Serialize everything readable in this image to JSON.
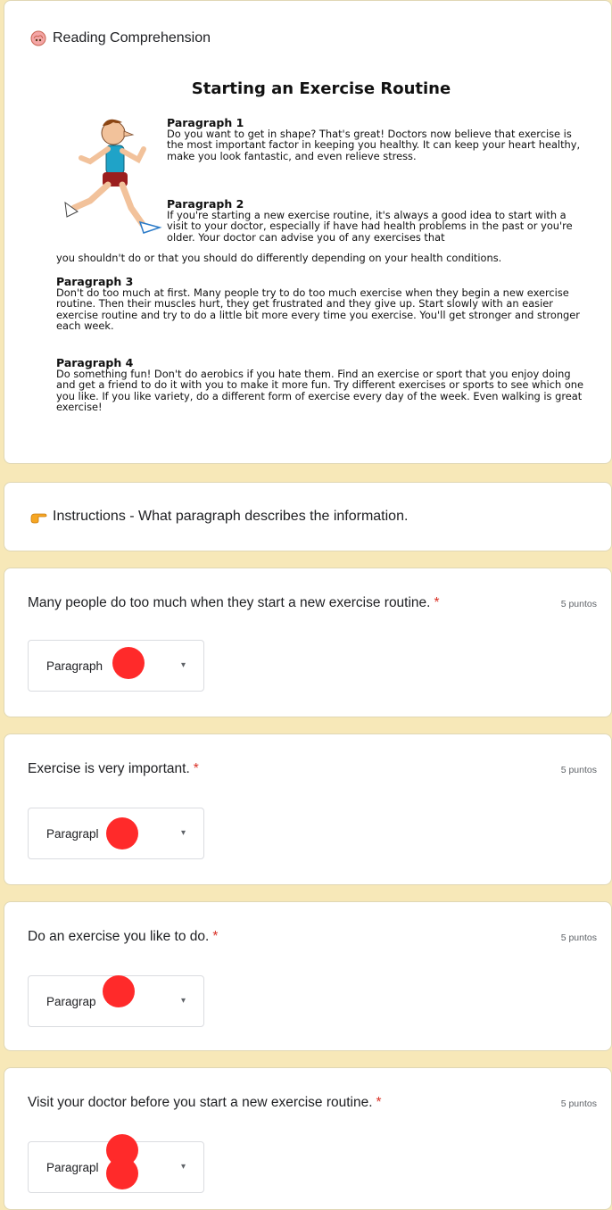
{
  "reading_card": {
    "icon": "brain-emoji-icon",
    "header": "Reading Comprehension",
    "passage": {
      "title": "Starting an Exercise Routine",
      "paragraphs": [
        {
          "heading": "Paragraph 1",
          "text": "Do you want to get in shape?  That's great!  Doctors now believe that exercise is the most important factor in keeping you healthy.  It can keep your heart healthy, make you look fantastic, and even relieve stress."
        },
        {
          "heading": "Paragraph 2",
          "text": "If you're starting a new exercise routine, it's always a good idea to start with a visit to your doctor, especially if have had health problems in the past or you're older.  Your doctor can advise you of any exercises that",
          "tail": "you shouldn't do or that you should do differently depending on your health conditions."
        },
        {
          "heading": "Paragraph 3",
          "text": "Don't do too much at first.  Many people try to do too much exercise when they begin a new exercise routine.  Then their muscles hurt, they get frustrated and they give up.  Start slowly with an easier exercise routine and try to do a little bit more every time you exercise.  You'll get stronger and stronger each week."
        },
        {
          "heading": "Paragraph 4",
          "text": "Do something fun!  Don't do aerobics if you hate them.  Find an exercise or sport that you enjoy doing and get a friend to do it with you to make it more fun.  Try different exercises or sports to see which one you like.  If you like variety, do a different form of exercise every day of the week.  Even walking is great exercise!"
        }
      ]
    }
  },
  "instructions_card": {
    "icon": "pointing-hand-icon",
    "text": "Instructions - What paragraph describes the information."
  },
  "questions": [
    {
      "text": "Many people do too much when they start a new exercise routine.",
      "required": "*",
      "points": "5 puntos",
      "selected": "Paragraph"
    },
    {
      "text": "Exercise is very important.",
      "required": "*",
      "points": "5 puntos",
      "selected": "Paragrapl"
    },
    {
      "text": "Do an exercise you like to do.",
      "required": "*",
      "points": "5 puntos",
      "selected": "Paragrap"
    },
    {
      "text": "Visit your doctor before you start a new exercise routine.",
      "required": "*",
      "points": "5 puntos",
      "selected": "Paragrapl"
    }
  ],
  "colors": {
    "background": "#f7e8b8",
    "required_star": "#d93025",
    "redaction": "#ff2a2a"
  }
}
